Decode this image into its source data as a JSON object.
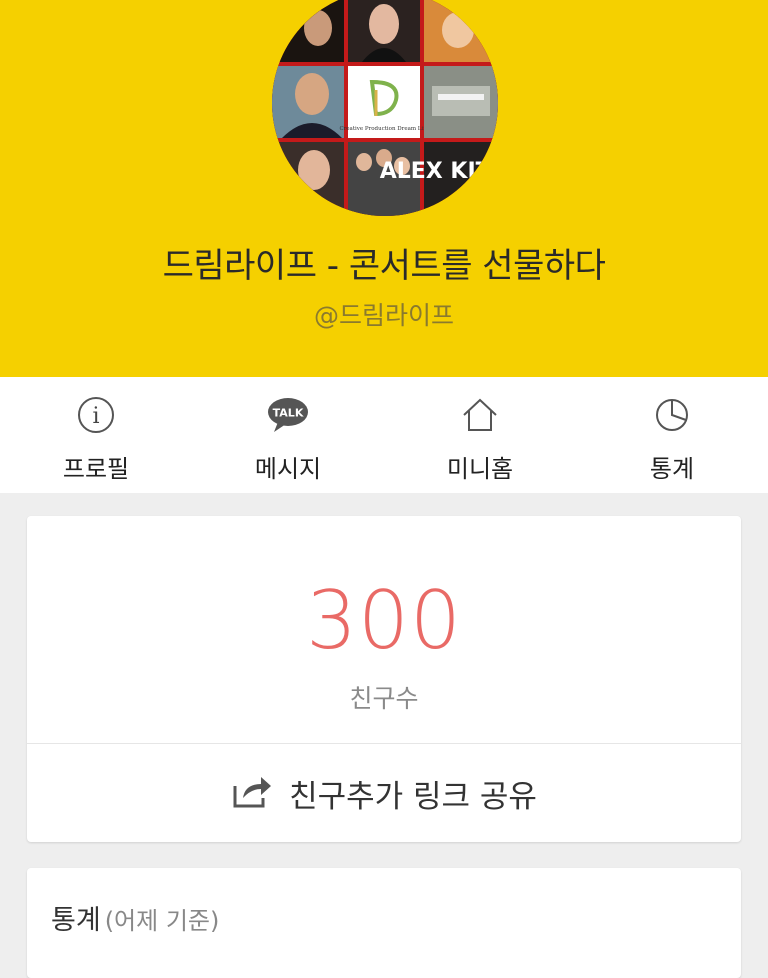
{
  "profile": {
    "name": "드림라이프 - 콘서트를 선물하다",
    "handle": "@드림라이프",
    "avatar_logo_text": "Creative Production Dream Life",
    "avatar_sign_text": "ALEX KITCHE"
  },
  "tabs": [
    {
      "label": "프로필",
      "icon": "info-icon"
    },
    {
      "label": "메시지",
      "icon": "talk-bubble-icon",
      "icon_text": "TALK"
    },
    {
      "label": "미니홈",
      "icon": "home-icon"
    },
    {
      "label": "통계",
      "icon": "pie-chart-icon"
    }
  ],
  "friends": {
    "count": "300",
    "label": "친구수",
    "share_label": "친구추가 링크 공유",
    "share_icon": "share-icon"
  },
  "stats": {
    "title": "통계",
    "subtitle": "(어제 기준)"
  },
  "colors": {
    "header_bg": "#f5d000",
    "count": "#e96a66",
    "page_bg": "#eeeeee"
  }
}
